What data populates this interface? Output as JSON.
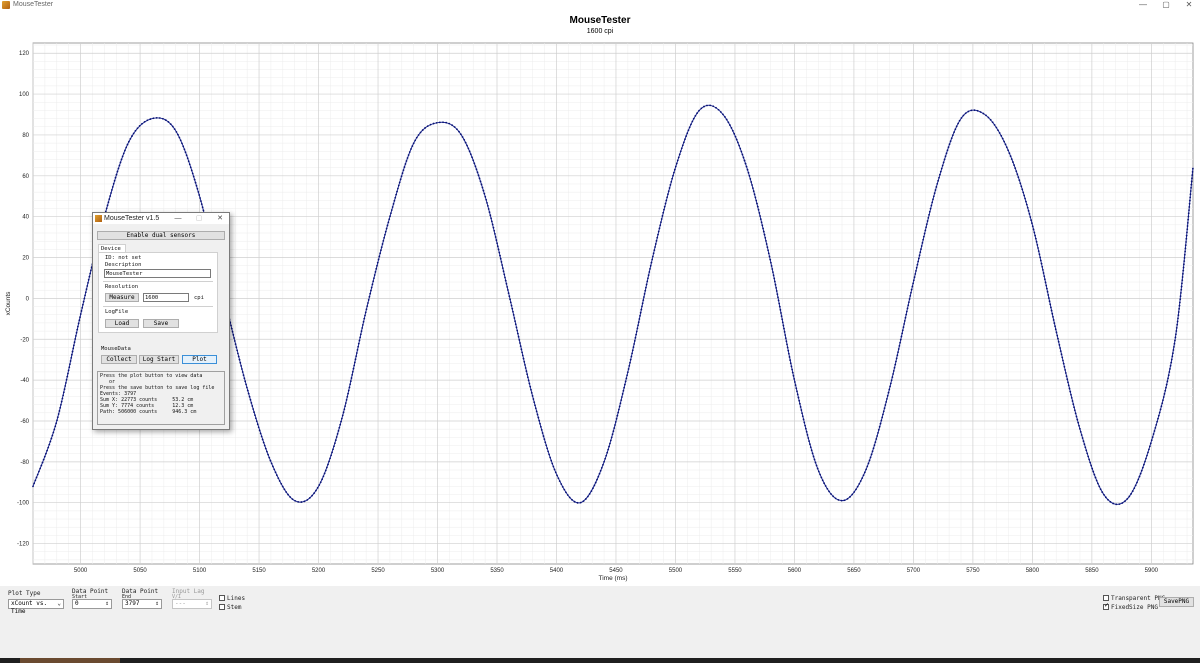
{
  "window": {
    "title": "MouseTester",
    "buttons": {
      "minimize": "—",
      "maximize": "▢",
      "close": "✕"
    }
  },
  "chart_data": {
    "type": "line",
    "title": "MouseTester",
    "subtitle": "1600 cpi",
    "xlabel": "Time (ms)",
    "ylabel": "xCounts",
    "xlim": [
      4960,
      5935
    ],
    "ylim": [
      -130,
      125
    ],
    "xticks": [
      5000,
      5050,
      5100,
      5150,
      5200,
      5250,
      5300,
      5350,
      5400,
      5450,
      5500,
      5550,
      5600,
      5650,
      5700,
      5750,
      5800,
      5850,
      5900
    ],
    "yticks": [
      120,
      100,
      80,
      60,
      40,
      20,
      0,
      -20,
      -40,
      -60,
      -80,
      -100,
      -120
    ],
    "grid": true,
    "series": [
      {
        "color": "#1f2a9a",
        "marker": "dot",
        "x": [
          4960,
          4980,
          5000,
          5020,
          5040,
          5060,
          5080,
          5100,
          5120,
          5140,
          5160,
          5180,
          5200,
          5220,
          5240,
          5260,
          5280,
          5300,
          5320,
          5340,
          5360,
          5380,
          5400,
          5420,
          5440,
          5460,
          5480,
          5500,
          5520,
          5540,
          5560,
          5580,
          5600,
          5620,
          5640,
          5660,
          5680,
          5700,
          5720,
          5740,
          5760,
          5780,
          5800,
          5820,
          5840,
          5860,
          5880,
          5900,
          5920,
          5935
        ],
        "y": [
          -92,
          -60,
          -8,
          40,
          76,
          88,
          82,
          50,
          2,
          -44,
          -80,
          -99,
          -92,
          -58,
          -6,
          40,
          76,
          86,
          80,
          50,
          2,
          -48,
          -86,
          -100,
          -80,
          -36,
          18,
          64,
          92,
          90,
          64,
          18,
          -40,
          -84,
          -99,
          -84,
          -44,
          8,
          56,
          88,
          90,
          72,
          36,
          -16,
          -64,
          -96,
          -98,
          -70,
          -20,
          64
        ]
      }
    ]
  },
  "controls": {
    "plot_type": {
      "label": "Plot Type",
      "value": "xCount vs. Time"
    },
    "data_point_start": {
      "label": "Data Point",
      "sublabel": "Start",
      "value": "0"
    },
    "data_point_end": {
      "label": "Data Point",
      "sublabel": "End",
      "value": "3797"
    },
    "input_lag": {
      "label": "Input Lag",
      "sublabel": "V/I",
      "value": "---"
    },
    "lines": {
      "label": "Lines",
      "checked": false
    },
    "stem": {
      "label": "Stem",
      "checked": false
    },
    "transparent_png": {
      "label": "Transparent PNG",
      "checked": false
    },
    "fixed_size_png": {
      "label": "FixedSize PNG",
      "checked": true
    },
    "save_png": "SavePNG"
  },
  "dialog": {
    "title": "MouseTester v1.5",
    "buttons": {
      "minimize": "—",
      "maximize": "▢",
      "close": "✕"
    },
    "toggle_button": "Enable dual sensors",
    "tab": "Device 1",
    "id_line": "ID: not set",
    "description_label": "Description",
    "description_value": "MouseTester",
    "resolution_label": "Resolution",
    "measure_button": "Measure",
    "resolution_value": "1600",
    "resolution_unit": "cpi",
    "logfile_label": "LogFile",
    "load_button": "Load",
    "save_button": "Save",
    "mousedata_label": "MouseData",
    "collect_button": "Collect",
    "logstart_button": "Log Start",
    "plot_button": "Plot",
    "log_lines": [
      "Press the plot button to view data",
      "   or",
      "Press the save button to save log file",
      "Events: 3797",
      "Sum X: 22773 counts     53.2 cm",
      "Sum Y: 7774 counts      12.3 cm",
      "Path: 506000 counts     946.3 cm"
    ]
  }
}
